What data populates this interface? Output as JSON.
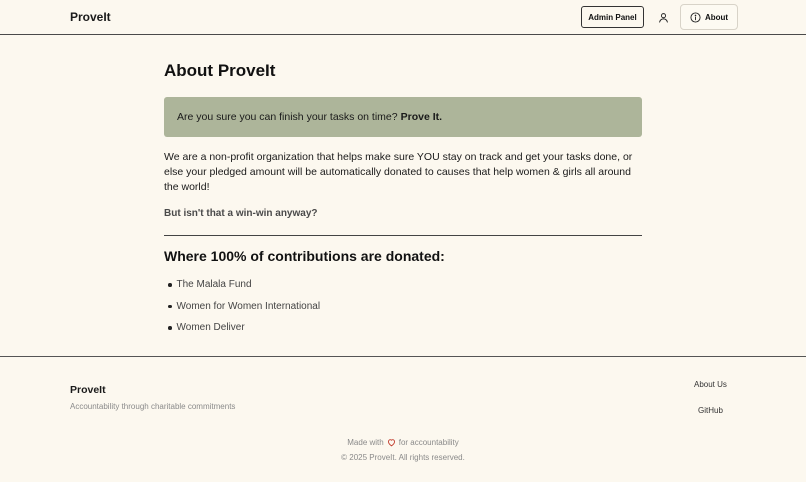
{
  "header": {
    "brand": "ProveIt",
    "admin_label": "Admin Panel",
    "about_label": "About"
  },
  "main": {
    "title": "About ProveIt",
    "callout_text": "Are you sure you can finish your tasks on time?",
    "callout_bold": "Prove It.",
    "intro": "We are a non-profit organization that helps make sure YOU stay on track and get your tasks done, or else your pledged amount will be automatically donated to causes that help women & girls all around the world!",
    "winwin": "But isn't that a win-win anyway?",
    "section_title": "Where 100% of contributions are donated:",
    "organizations": [
      "The Malala Fund",
      "Women for Women International",
      "Women Deliver"
    ]
  },
  "footer": {
    "brand": "ProveIt",
    "tagline": "Accountability through charitable commitments",
    "links": [
      "About Us",
      "GitHub"
    ],
    "made_with_prefix": "Made with",
    "made_with_suffix": "for accountability",
    "copyright": "© 2025 ProveIt. All rights reserved."
  },
  "colors": {
    "background": "#fcf8ef",
    "callout": "#adb59a",
    "heart": "#c0392b"
  },
  "icons": {
    "user": "user-icon",
    "info": "info-icon",
    "heart": "heart-icon"
  }
}
